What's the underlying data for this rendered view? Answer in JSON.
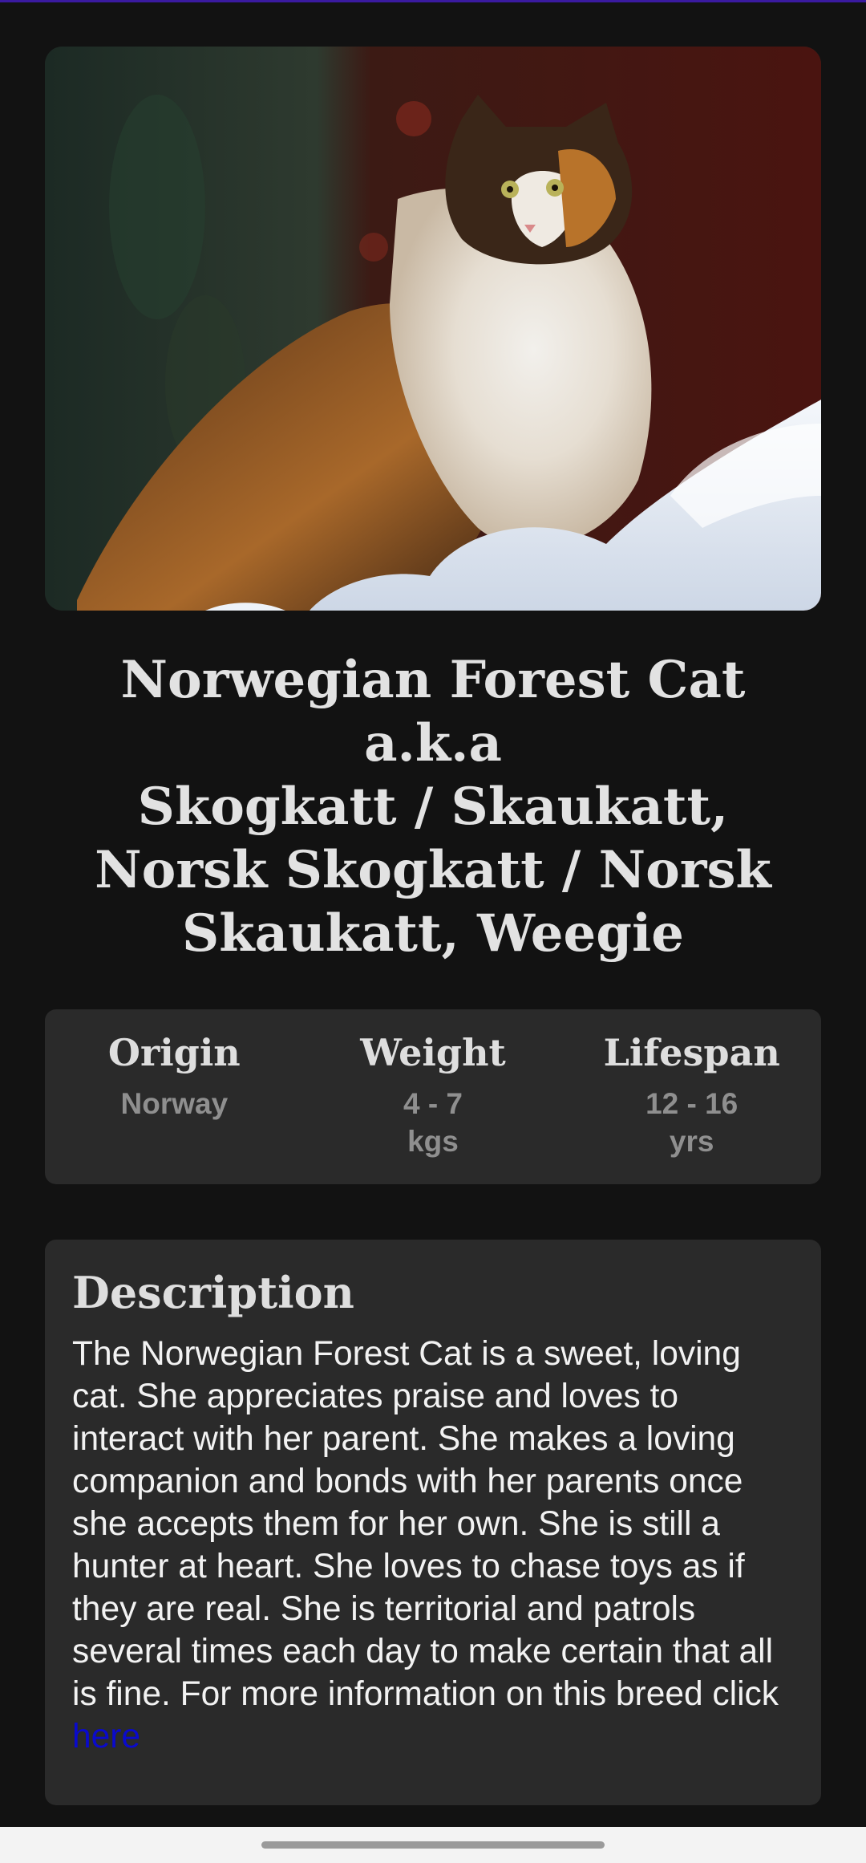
{
  "breed": {
    "name": "Norwegian Forest Cat",
    "aka_label": "a.k.a",
    "alt_names": "Skogkatt / Skaukatt, Norsk Skogkatt / Norsk Skaukatt, Weegie",
    "image_description": "Calico long-haired cat sitting in snow"
  },
  "stats": [
    {
      "label": "Origin",
      "value": "Norway"
    },
    {
      "label": "Weight",
      "value": "4 - 7 kgs"
    },
    {
      "label": "Lifespan",
      "value": "12 - 16 yrs"
    }
  ],
  "description": {
    "heading": "Description",
    "body": "The Norwegian Forest Cat is a sweet, loving cat. She appreciates praise and loves to interact with her parent. She makes a loving companion and bonds with her parents once she accepts them for her own. She is still a hunter at heart. She loves to chase toys as if they are real. She is territorial and patrols several times each day to make certain that all is fine. For more information on this breed click ",
    "link_text": "here"
  },
  "colors": {
    "background": "#121212",
    "card": "#2a2a2a",
    "heading_text": "#e2e2e2",
    "stat_value_text": "#8f8f8f",
    "link": "#0a0acc",
    "accent": "#3a1aa0"
  }
}
